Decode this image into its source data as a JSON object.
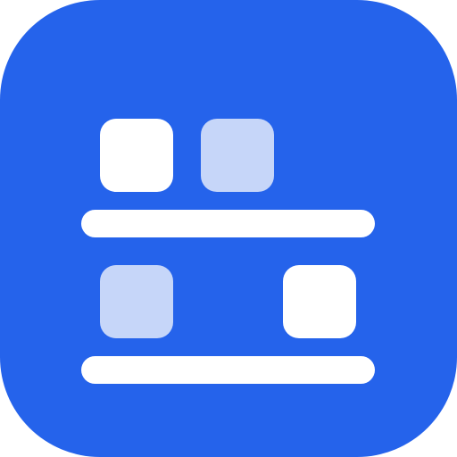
{
  "icon": {
    "semantic": "shelf-board-icon",
    "colors": {
      "background": "#2563EB",
      "primary_block": "#FFFFFF",
      "secondary_block": "#C6D6F9",
      "shelf": "#FFFFFF"
    },
    "rows": [
      {
        "items": [
          "solid",
          "light"
        ]
      },
      {
        "items": [
          "light",
          "solid"
        ]
      }
    ]
  }
}
